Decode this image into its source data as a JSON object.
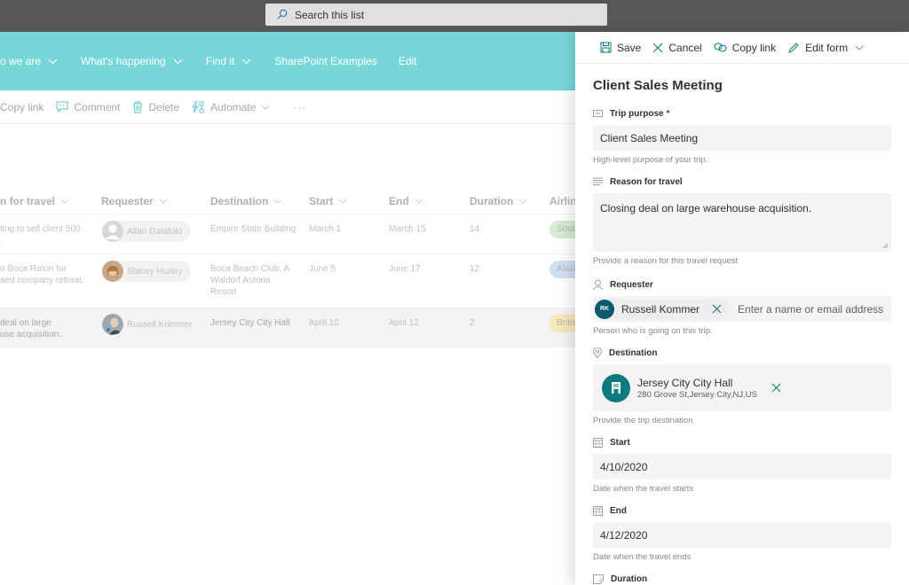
{
  "search": {
    "placeholder": "Search this list"
  },
  "nav": {
    "items": [
      {
        "label": "o we are",
        "has_chevron": true
      },
      {
        "label": "What's happening",
        "has_chevron": true
      },
      {
        "label": "Find it",
        "has_chevron": true
      },
      {
        "label": "SharePoint Examples",
        "has_chevron": false
      },
      {
        "label": "Edit",
        "has_chevron": false
      }
    ]
  },
  "commandbar": {
    "copy_link": "Copy link",
    "comment": "Comment",
    "delete": "Delete",
    "automate": "Automate",
    "more": "···"
  },
  "list": {
    "columns": [
      "n for travel",
      "Requester",
      "Destination",
      "Start",
      "End",
      "Duration",
      "Airlin"
    ],
    "rows": [
      {
        "reason": [
          "ting to sell client 500",
          "."
        ],
        "requester": "Allan Galatolo",
        "destination": [
          "Empire State Building"
        ],
        "start": "March 1",
        "end": "March 15",
        "duration": "14",
        "airline": "Southwest",
        "airline_color": "#d4ecd1",
        "selected": false
      },
      {
        "reason": [
          "o Boca Raton for",
          "aed company retreat."
        ],
        "requester": "Stacey Hurley",
        "destination": [
          "Boca Beach Club, A",
          "Waldorf Astoria",
          "Resort"
        ],
        "start": "June 5",
        "end": "June 17",
        "duration": "12",
        "airline": "Alaska",
        "airline_color": "#cfe0f1",
        "selected": false
      },
      {
        "reason": [
          "deal on large",
          "use acquisition."
        ],
        "requester": "Russell Kommer",
        "destination": [
          "Jersey City City Hall"
        ],
        "start": "April 10",
        "end": "April 12",
        "duration": "2",
        "airline": "British",
        "airline_color": "#f5e9b8",
        "selected": true
      }
    ]
  },
  "panel": {
    "toolbar": {
      "save": "Save",
      "cancel": "Cancel",
      "copy_link": "Copy link",
      "edit_form": "Edit form"
    },
    "title": "Client Sales Meeting",
    "fields": {
      "trip_purpose": {
        "label": "Trip purpose",
        "required_mark": "*",
        "value": "Client Sales Meeting",
        "help": "High-level purpose of your trip."
      },
      "reason": {
        "label": "Reason for travel",
        "value": "Closing deal on large warehouse acquisition.",
        "help": "Provide a reason for this travel request"
      },
      "requester": {
        "label": "Requester",
        "initials": "RK",
        "name": "Russell Kommer",
        "placeholder": "Enter a name or email address",
        "help": "Person who is going on this trip."
      },
      "destination": {
        "label": "Destination",
        "name": "Jersey City City Hall",
        "address": "280 Grove St,Jersey City,NJ,US",
        "help": "Provide the trip destination"
      },
      "start": {
        "label": "Start",
        "value": "4/10/2020",
        "help": "Date when the travel starts"
      },
      "end": {
        "label": "End",
        "value": "4/12/2020",
        "help": "Date when the travel ends"
      },
      "duration": {
        "label": "Duration"
      }
    }
  },
  "colors": {
    "nav_bg": "#78d6d8",
    "accent": "#03787c",
    "topbar": "#575757"
  }
}
